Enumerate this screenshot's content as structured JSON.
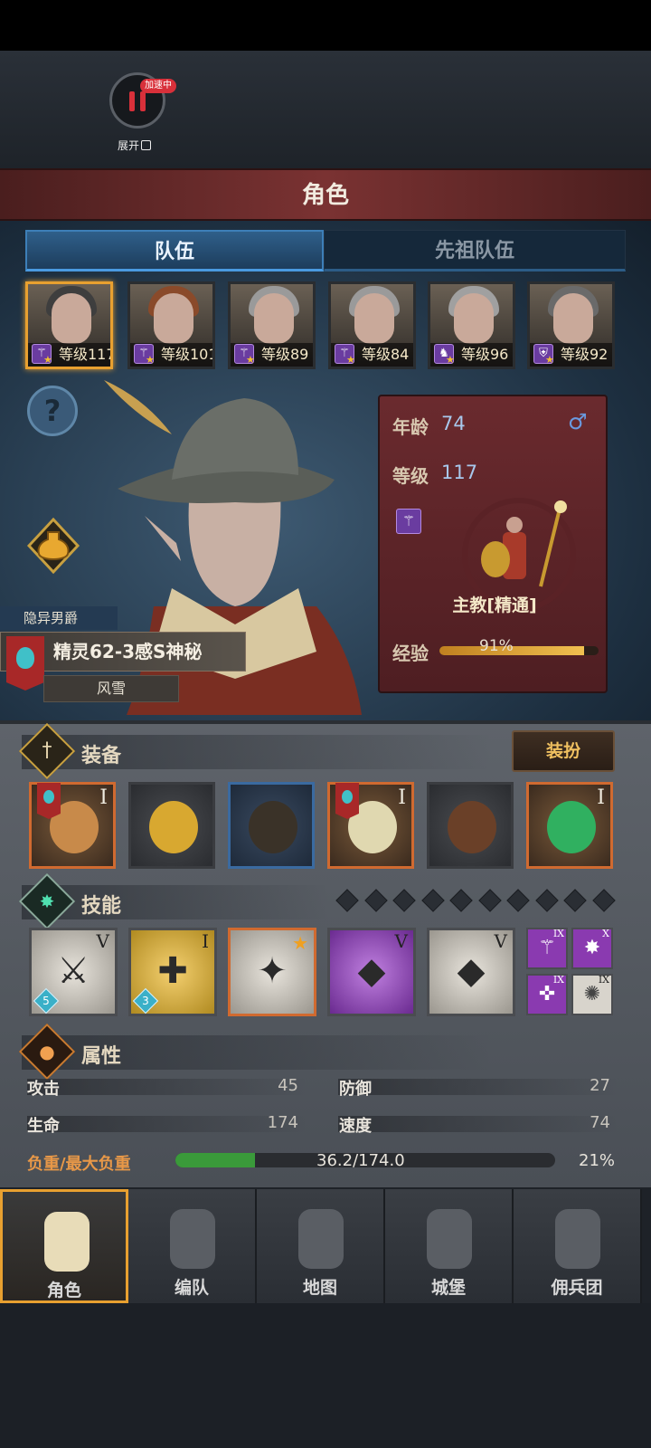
{
  "hud": {
    "speed_badge": "加速中",
    "expand_label": "展开"
  },
  "title": "角色",
  "tabs": [
    {
      "label": "队伍"
    },
    {
      "label": "先祖队伍"
    }
  ],
  "heroes": [
    {
      "level": "等级117",
      "class_icon": "staff-icon",
      "selected": true
    },
    {
      "level": "等级101",
      "class_icon": "staff-icon"
    },
    {
      "level": "等级89",
      "class_icon": "staff-icon"
    },
    {
      "level": "等级84",
      "class_icon": "staff-icon"
    },
    {
      "level": "等级96",
      "class_icon": "horse-icon"
    },
    {
      "level": "等级92",
      "class_icon": "shield-icon"
    }
  ],
  "character": {
    "title": "隐异男爵",
    "race_line": "精灵62-3感S神秘",
    "weather": "风雪",
    "age_label": "年龄",
    "age": "74",
    "level_label": "等级",
    "level": "117",
    "job": "主教[精通]",
    "xp_label": "经验",
    "xp_percent": "91%",
    "xp_fraction": 0.91,
    "gender_icon": "male-icon"
  },
  "equipment": {
    "label": "装备",
    "dress_button": "装扮",
    "items": [
      {
        "name": "dragon-staff",
        "tier": "I",
        "banner": true,
        "frame": "orange"
      },
      {
        "name": "golden-shield",
        "tier": "",
        "banner": false,
        "frame": "gray"
      },
      {
        "name": "hood",
        "tier": "",
        "banner": false,
        "frame": "blue"
      },
      {
        "name": "golden-robe",
        "tier": "I",
        "banner": true,
        "frame": "orange"
      },
      {
        "name": "leather-boots",
        "tier": "",
        "banner": false,
        "frame": "gray"
      },
      {
        "name": "emerald-gem",
        "tier": "I",
        "banner": false,
        "frame": "orange"
      }
    ]
  },
  "skills": {
    "label": "技能",
    "slots_total": 10,
    "items": [
      {
        "tier": "V",
        "style": "white",
        "badge": "5",
        "symbol": "⚔"
      },
      {
        "tier": "I",
        "style": "gold",
        "badge": "3",
        "symbol": "✚"
      },
      {
        "tier": "",
        "style": "white",
        "badge": "",
        "symbol": "✦",
        "starred": true
      },
      {
        "tier": "V",
        "style": "purple",
        "badge": "",
        "symbol": "◆"
      },
      {
        "tier": "V",
        "style": "white",
        "badge": "",
        "symbol": "◆"
      }
    ],
    "mini": [
      {
        "tier": "IX",
        "symbol": "⚚"
      },
      {
        "tier": "X",
        "symbol": "✸"
      },
      {
        "tier": "IX",
        "symbol": "✜"
      },
      {
        "tier": "IX",
        "symbol": "✺"
      }
    ]
  },
  "attributes": {
    "label": "属性",
    "attack_label": "攻击",
    "attack": "45",
    "defense_label": "防御",
    "defense": "27",
    "hp_label": "生命",
    "hp": "174",
    "speed_label": "速度",
    "speed": "74",
    "load_label": "负重/最大负重",
    "load_value": "36.2/174.0",
    "load_percent": "21%",
    "load_fraction": 0.21
  },
  "nav": [
    {
      "label": "角色",
      "icon": "knight-icon",
      "active": true
    },
    {
      "label": "编队",
      "icon": "helmet-icon"
    },
    {
      "label": "地图",
      "icon": "compass-icon"
    },
    {
      "label": "城堡",
      "icon": "castle-icon"
    },
    {
      "label": "佣兵团",
      "icon": "mercenary-icon"
    }
  ],
  "colors": {
    "accent": "#e8a030",
    "tab_active": "#2f5f8a",
    "card": "#6a2a2e",
    "xp": "#f0c050",
    "load": "#3a9a3a"
  }
}
